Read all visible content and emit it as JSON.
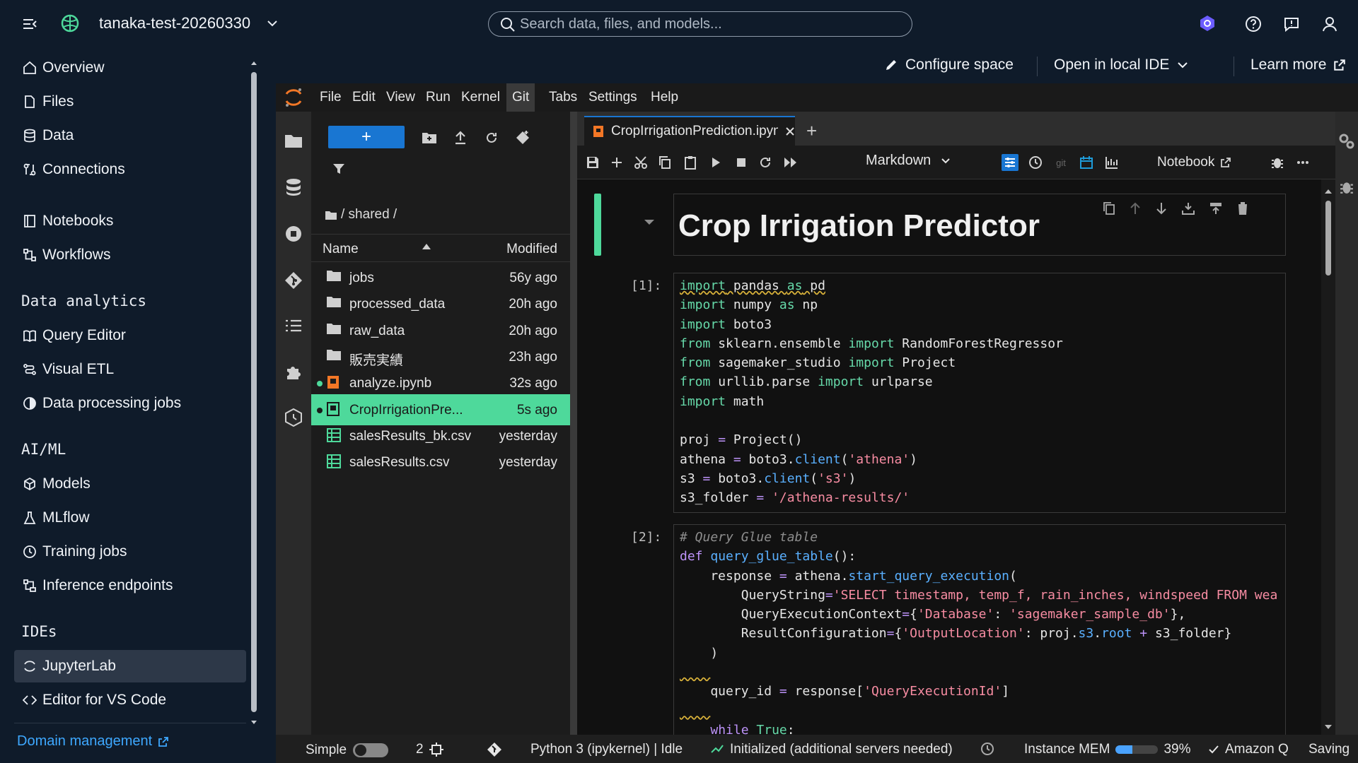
{
  "topbar": {
    "project_name": "tanaka-test-20260330",
    "search_placeholder": "Search data, files, and models..."
  },
  "leftnav": {
    "items_top": [
      {
        "label": "Overview",
        "icon": "home-icon"
      },
      {
        "label": "Files",
        "icon": "file-icon"
      },
      {
        "label": "Data",
        "icon": "database-icon"
      },
      {
        "label": "Connections",
        "icon": "connections-icon"
      }
    ],
    "items_mid": [
      {
        "label": "Notebooks",
        "icon": "notebook-icon"
      },
      {
        "label": "Workflows",
        "icon": "workflow-icon"
      }
    ],
    "section_analytics": "Data analytics",
    "items_analytics": [
      {
        "label": "Query Editor",
        "icon": "book-icon"
      },
      {
        "label": "Visual ETL",
        "icon": "etl-icon"
      },
      {
        "label": "Data processing jobs",
        "icon": "processing-icon"
      }
    ],
    "section_aiml": "AI/ML",
    "items_aiml": [
      {
        "label": "Models",
        "icon": "cube-icon"
      },
      {
        "label": "MLflow",
        "icon": "flask-icon"
      },
      {
        "label": "Training jobs",
        "icon": "clock-icon"
      },
      {
        "label": "Inference endpoints",
        "icon": "endpoint-icon"
      }
    ],
    "section_ides": "IDEs",
    "items_ides": [
      {
        "label": "JupyterLab",
        "icon": "jupyter-icon",
        "active": true
      },
      {
        "label": "Editor for VS Code",
        "icon": "code-icon"
      }
    ],
    "domain_management": "Domain management"
  },
  "spacebar": {
    "configure": "Configure space",
    "open_local": "Open in local IDE",
    "learn_more": "Learn more"
  },
  "jupyter": {
    "menus": [
      "File",
      "Edit",
      "View",
      "Run",
      "Kernel",
      "Git",
      "Tabs",
      "Settings",
      "Help"
    ],
    "breadcrumb": "/ shared /",
    "col_name": "Name",
    "col_modified": "Modified",
    "files": [
      {
        "name": "jobs",
        "modified": "56y ago",
        "type": "folder"
      },
      {
        "name": "processed_data",
        "modified": "20h ago",
        "type": "folder"
      },
      {
        "name": "raw_data",
        "modified": "20h ago",
        "type": "folder"
      },
      {
        "name": "販売実績",
        "modified": "23h ago",
        "type": "folder"
      },
      {
        "name": "analyze.ipynb",
        "modified": "32s ago",
        "type": "notebook",
        "running": true
      },
      {
        "name": "CropIrrigationPre...",
        "modified": "5s ago",
        "type": "notebook",
        "running": true,
        "selected": true
      },
      {
        "name": "salesResults_bk.csv",
        "modified": "yesterday",
        "type": "csv"
      },
      {
        "name": "salesResults.csv",
        "modified": "yesterday",
        "type": "csv"
      }
    ],
    "tab_name": "CropIrrigationPrediction.ipynb",
    "cell_type": "Markdown",
    "kernel_label": "Notebook",
    "title": "Crop Irrigation Predictor",
    "prompt1": "[1]:",
    "prompt2": "[2]:",
    "status": {
      "mode": "Simple",
      "terminals": "2",
      "kernel": "Python 3 (ipykernel) | Idle",
      "lsp": "Initialized (additional servers needed)",
      "mem_label": "Instance MEM",
      "mem_percent": "39%",
      "mem_fraction": 0.39,
      "amazonq": "Amazon Q",
      "saving": "Saving"
    }
  },
  "colors": {
    "accent_green": "#4ed99b",
    "accent_blue": "#1976d2",
    "link_blue": "#3ea8ff",
    "bg_dark": "#0f1b2a"
  }
}
